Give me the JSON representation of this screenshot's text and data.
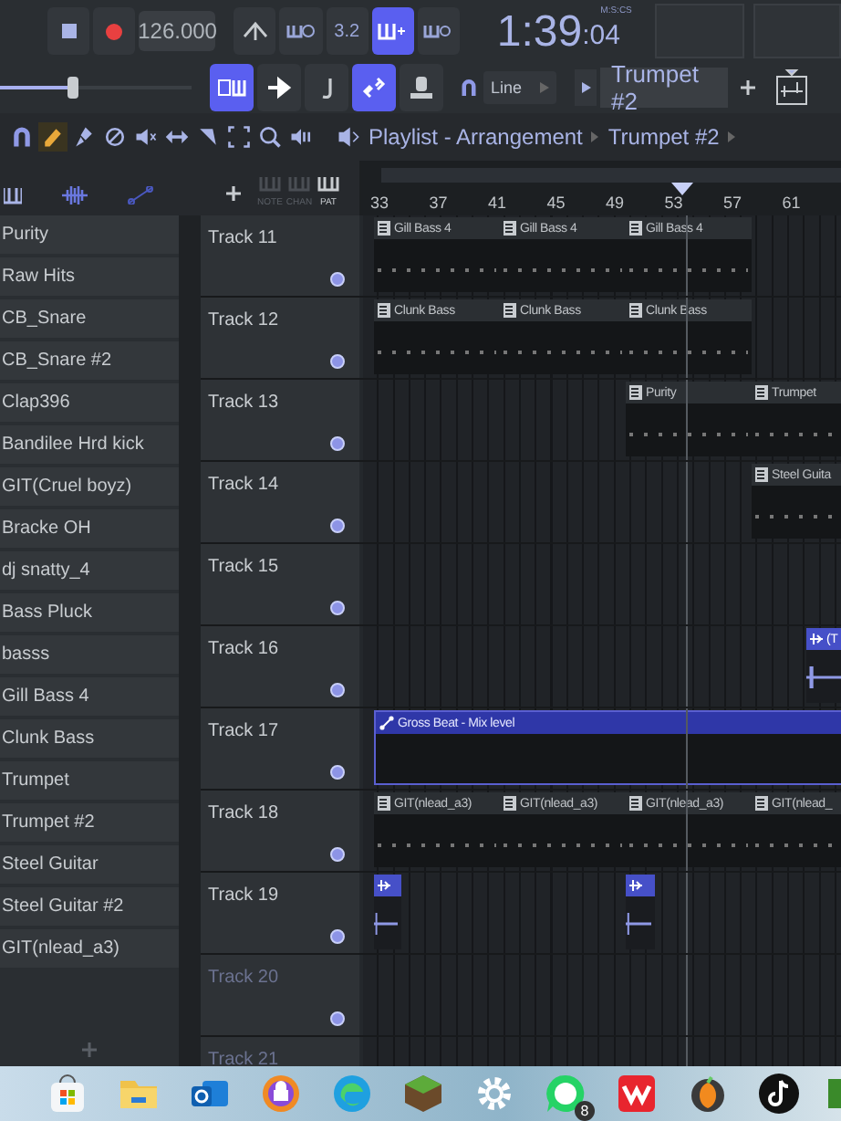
{
  "transport": {
    "tempo": "126.000",
    "time_main": "1:39",
    "time_sub": ":04",
    "time_unit": "M:S:CS"
  },
  "toolbar_row1": [
    {
      "kind": "typing",
      "on": false
    },
    {
      "kind": "wait",
      "on": false
    },
    {
      "kind": "countdown",
      "label": "3.2",
      "on": false
    },
    {
      "kind": "blend",
      "on": true
    },
    {
      "kind": "loop",
      "on": false
    }
  ],
  "toolbar_row2": [
    {
      "kind": "pattern-song",
      "on": true
    },
    {
      "kind": "arrow",
      "on": false
    },
    {
      "kind": "note",
      "on": false
    },
    {
      "kind": "link",
      "on": true
    },
    {
      "kind": "knob",
      "on": false
    }
  ],
  "master_volume": {
    "level": 0.38
  },
  "snap": {
    "value": "Line"
  },
  "pattern": {
    "value": "Trumpet #2"
  },
  "tools": [
    {
      "kind": "magnet",
      "selected": false
    },
    {
      "kind": "pencil",
      "selected": true
    },
    {
      "kind": "brush",
      "selected": false
    },
    {
      "kind": "delete",
      "selected": false
    },
    {
      "kind": "mute",
      "selected": false
    },
    {
      "kind": "slip",
      "selected": false
    },
    {
      "kind": "slice",
      "selected": false
    },
    {
      "kind": "select",
      "selected": false
    },
    {
      "kind": "zoom",
      "selected": false
    },
    {
      "kind": "playback",
      "selected": false
    }
  ],
  "playlist": {
    "title": "Playlist - Arrangement",
    "pattern": "Trumpet #2"
  },
  "rack_filters": [
    {
      "label": "NOTE",
      "selected": false
    },
    {
      "label": "CHAN",
      "selected": false
    },
    {
      "label": "PAT",
      "selected": true
    }
  ],
  "ruler": [
    "33",
    "37",
    "41",
    "45",
    "49",
    "53",
    "57",
    "61"
  ],
  "channels": [
    "Purity",
    "Raw Hits",
    "CB_Snare",
    "CB_Snare #2",
    "Clap396",
    "Bandilee Hrd kick",
    "GIT(Cruel boyz)",
    "Bracke OH",
    "dj snatty_4",
    "Bass Pluck",
    "basss",
    "Gill Bass 4",
    "Clunk Bass",
    "Trumpet",
    "Trumpet #2",
    "Steel Guitar",
    "Steel Guitar #2",
    "GIT(nlead_a3)"
  ],
  "tracks": [
    {
      "name": "Track 11",
      "disabled": false,
      "clips": [
        {
          "kind": "pattern",
          "label": "Gill Bass 4"
        },
        {
          "kind": "pattern",
          "label": "Gill Bass 4"
        },
        {
          "kind": "pattern",
          "label": "Gill Bass 4"
        }
      ]
    },
    {
      "name": "Track 12",
      "disabled": false,
      "clips": [
        {
          "kind": "pattern",
          "label": "Clunk Bass"
        },
        {
          "kind": "pattern",
          "label": "Clunk Bass"
        },
        {
          "kind": "pattern",
          "label": "Clunk Bass"
        }
      ]
    },
    {
      "name": "Track 13",
      "disabled": false,
      "clips": [
        {
          "kind": "pattern",
          "label": "Purity"
        },
        {
          "kind": "pattern",
          "label": "Trumpet"
        }
      ]
    },
    {
      "name": "Track 14",
      "disabled": false,
      "clips": [
        {
          "kind": "pattern",
          "label": "Steel Guita"
        }
      ]
    },
    {
      "name": "Track 15",
      "disabled": false
    },
    {
      "name": "Track 16",
      "disabled": false,
      "clips": [
        {
          "kind": "audio",
          "label": "(T"
        }
      ]
    },
    {
      "name": "Track 17",
      "disabled": false,
      "clips": [
        {
          "kind": "automation",
          "label": "Gross Beat - Mix level"
        }
      ]
    },
    {
      "name": "Track 18",
      "disabled": false,
      "clips": [
        {
          "kind": "pattern",
          "label": "GIT(nlead_a3)"
        },
        {
          "kind": "pattern",
          "label": "GIT(nlead_a3)"
        },
        {
          "kind": "pattern",
          "label": "GIT(nlead_a3)"
        },
        {
          "kind": "pattern",
          "label": "GIT(nlead_"
        }
      ]
    },
    {
      "name": "Track 19",
      "disabled": false,
      "clips": [
        {
          "kind": "audio"
        },
        {
          "kind": "audio"
        }
      ]
    },
    {
      "name": "Track 20",
      "disabled": true
    },
    {
      "name": "Track 21",
      "disabled": true
    }
  ],
  "taskbar": [
    {
      "kind": "store"
    },
    {
      "kind": "folder"
    },
    {
      "kind": "mail"
    },
    {
      "kind": "shield"
    },
    {
      "kind": "browser"
    },
    {
      "kind": "block"
    },
    {
      "kind": "settings"
    },
    {
      "kind": "chat",
      "badge": "8"
    },
    {
      "kind": "office"
    },
    {
      "kind": "fruit"
    },
    {
      "kind": "music"
    },
    {
      "kind": "partial"
    }
  ]
}
